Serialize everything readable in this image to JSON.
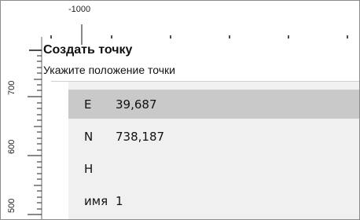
{
  "ruler": {
    "top_label": "-1000",
    "left_labels": [
      "700",
      "600",
      "500"
    ]
  },
  "dialog": {
    "title": "Создать точку",
    "prompt": "Укажите положение точки"
  },
  "fields": [
    {
      "key": "E",
      "value": "39,687",
      "selected": true
    },
    {
      "key": "N",
      "value": "738,187",
      "selected": false
    },
    {
      "key": "H",
      "value": "",
      "selected": false
    },
    {
      "key": "имя",
      "value": "1",
      "selected": false
    }
  ]
}
